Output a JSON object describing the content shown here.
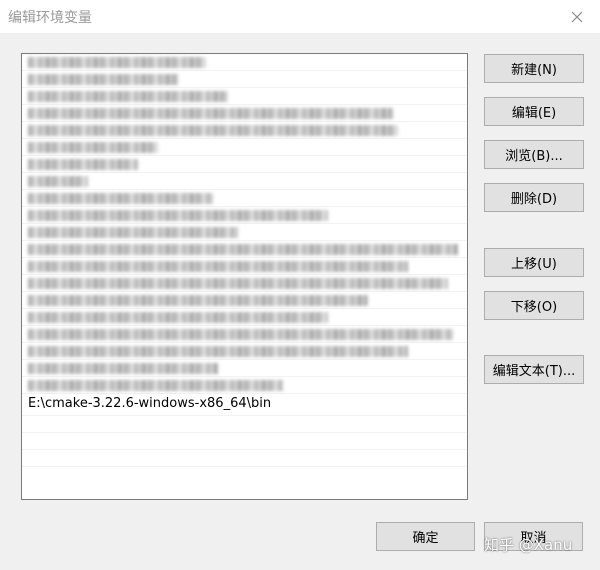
{
  "window": {
    "title": "编辑环境变量"
  },
  "list": {
    "visible_entry": "E:\\cmake-3.22.6-windows-x86_64\\bin"
  },
  "buttons": {
    "new": "新建(N)",
    "edit": "编辑(E)",
    "browse": "浏览(B)...",
    "delete": "删除(D)",
    "move_up": "上移(U)",
    "move_down": "下移(O)",
    "edit_text": "编辑文本(T)...",
    "ok": "确定",
    "cancel": "取消"
  },
  "watermark": "知乎 @Xanu",
  "icons": {
    "close": "close-icon"
  },
  "colors": {
    "titlebar": "#ffffff",
    "dialog_bg": "#f0f0f0",
    "button_bg": "#e1e1e1",
    "button_border": "#adadad"
  }
}
